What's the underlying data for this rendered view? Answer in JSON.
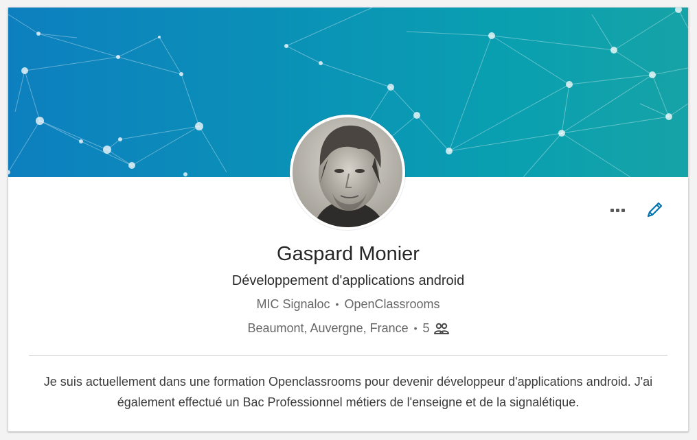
{
  "profile": {
    "name": "Gaspard Monier",
    "headline": "Développement d'applications android",
    "company": "MIC Signaloc",
    "school": "OpenClassrooms",
    "location": "Beaumont, Auvergne, France",
    "connections": "5",
    "summary": "Je suis actuellement dans une formation Openclassrooms pour devenir développeur d'applications android. J'ai également effectué un Bac Professionnel métiers de l'enseigne et de la signalétique."
  },
  "separator": "•",
  "icons": {
    "more": "more-options-icon",
    "edit": "pencil-icon",
    "connections": "people-icon"
  },
  "colors": {
    "banner_start": "#0d7fbf",
    "banner_end": "#16a3a7",
    "edit_accent": "#0073b1",
    "text_primary": "#262626",
    "text_secondary": "#666666"
  }
}
